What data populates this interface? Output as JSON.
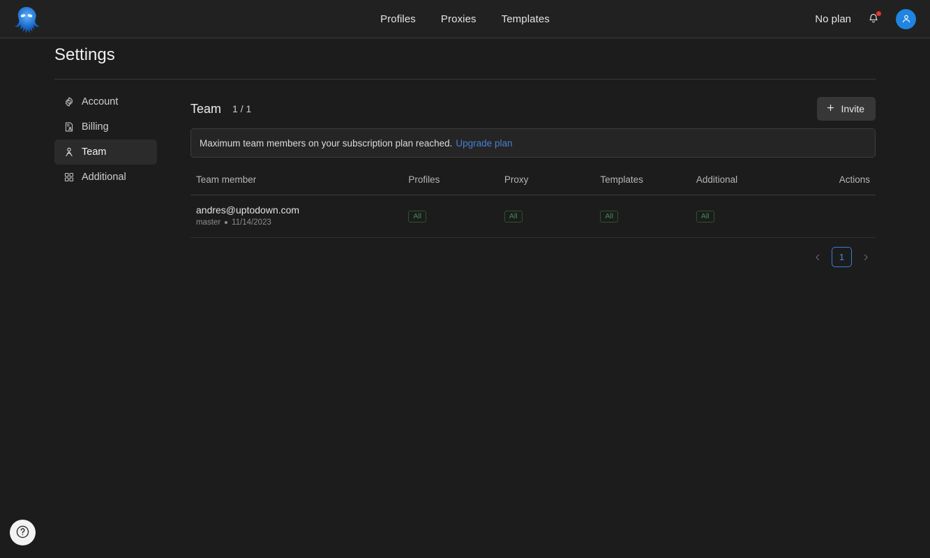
{
  "app": {
    "logo_icon": "kraken-logo-icon",
    "accent_blue": "#2084e0",
    "link_blue": "#4a7fd4",
    "badge_green": "#3f8f4f",
    "background": "#1c1c1c",
    "topbar_background": "#212121"
  },
  "topnav": {
    "items": [
      {
        "label": "Profiles",
        "name": "nav-profiles"
      },
      {
        "label": "Proxies",
        "name": "nav-proxies"
      },
      {
        "label": "Templates",
        "name": "nav-templates"
      }
    ]
  },
  "topright": {
    "plan_label": "No plan",
    "bell_icon": "notification-bell-icon",
    "has_notification": true,
    "avatar_icon": "user-avatar-icon"
  },
  "settings": {
    "title": "Settings"
  },
  "sidebar": {
    "items": [
      {
        "label": "Account",
        "icon": "gear-icon",
        "name": "sidebar-item-account",
        "active": false
      },
      {
        "label": "Billing",
        "icon": "invoice-icon",
        "name": "sidebar-item-billing",
        "active": false
      },
      {
        "label": "Team",
        "icon": "person-icon",
        "name": "sidebar-item-team",
        "active": true
      },
      {
        "label": "Additional",
        "icon": "grid-icon",
        "name": "sidebar-item-additional",
        "active": false
      }
    ]
  },
  "main": {
    "title": "Team",
    "count": "1 / 1",
    "invite_label": "Invite",
    "invite_icon": "plus-icon"
  },
  "alert": {
    "message": "Maximum team members on your subscription plan reached.",
    "link_label": "Upgrade plan"
  },
  "table": {
    "columns": [
      "Team member",
      "Profiles",
      "Proxy",
      "Templates",
      "Additional",
      "Actions"
    ],
    "rows": [
      {
        "email": "andres@uptodown.com",
        "role": "master",
        "date": "11/14/2023",
        "profiles": "All",
        "proxy": "All",
        "templates": "All",
        "additional": "All",
        "actions": ""
      }
    ]
  },
  "pagination": {
    "prev_icon": "chevron-left-icon",
    "next_icon": "chevron-right-icon",
    "current_page": "1"
  },
  "help": {
    "icon": "help-question-icon",
    "label": "?"
  }
}
